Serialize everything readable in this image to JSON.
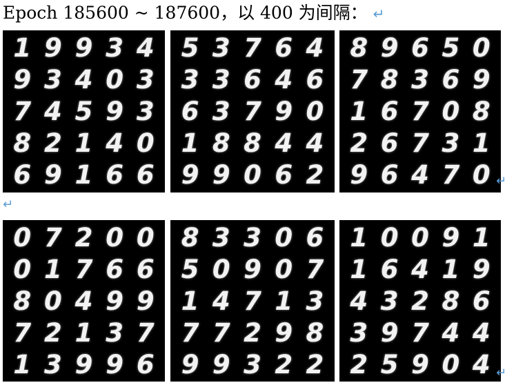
{
  "heading": {
    "text": "Epoch 185600 ~ 187600，以 400 为间隔：",
    "return_mark": "↵"
  },
  "panels": [
    [
      [
        "1",
        "9",
        "9",
        "3",
        "4"
      ],
      [
        "9",
        "3",
        "4",
        "0",
        "3"
      ],
      [
        "7",
        "4",
        "5",
        "9",
        "3"
      ],
      [
        "8",
        "2",
        "1",
        "4",
        "0"
      ],
      [
        "6",
        "9",
        "1",
        "6",
        "6"
      ]
    ],
    [
      [
        "5",
        "3",
        "7",
        "6",
        "4"
      ],
      [
        "3",
        "3",
        "6",
        "4",
        "6"
      ],
      [
        "6",
        "3",
        "7",
        "9",
        "0"
      ],
      [
        "1",
        "8",
        "8",
        "4",
        "4"
      ],
      [
        "9",
        "9",
        "0",
        "6",
        "2"
      ]
    ],
    [
      [
        "8",
        "9",
        "6",
        "5",
        "0"
      ],
      [
        "7",
        "8",
        "3",
        "6",
        "9"
      ],
      [
        "1",
        "6",
        "7",
        "0",
        "8"
      ],
      [
        "2",
        "6",
        "7",
        "3",
        "1"
      ],
      [
        "9",
        "6",
        "4",
        "7",
        "0"
      ]
    ],
    [
      [
        "0",
        "7",
        "2",
        "0",
        "0"
      ],
      [
        "0",
        "1",
        "7",
        "6",
        "6"
      ],
      [
        "8",
        "0",
        "4",
        "9",
        "9"
      ],
      [
        "7",
        "2",
        "1",
        "3",
        "7"
      ],
      [
        "1",
        "3",
        "9",
        "9",
        "6"
      ]
    ],
    [
      [
        "8",
        "3",
        "3",
        "0",
        "6"
      ],
      [
        "5",
        "0",
        "9",
        "0",
        "7"
      ],
      [
        "1",
        "4",
        "7",
        "1",
        "3"
      ],
      [
        "7",
        "7",
        "2",
        "9",
        "8"
      ],
      [
        "9",
        "9",
        "3",
        "2",
        "2"
      ]
    ],
    [
      [
        "1",
        "0",
        "0",
        "9",
        "1"
      ],
      [
        "1",
        "6",
        "4",
        "1",
        "9"
      ],
      [
        "4",
        "3",
        "2",
        "8",
        "6"
      ],
      [
        "3",
        "9",
        "7",
        "4",
        "4"
      ],
      [
        "2",
        "5",
        "9",
        "0",
        "4"
      ]
    ]
  ]
}
